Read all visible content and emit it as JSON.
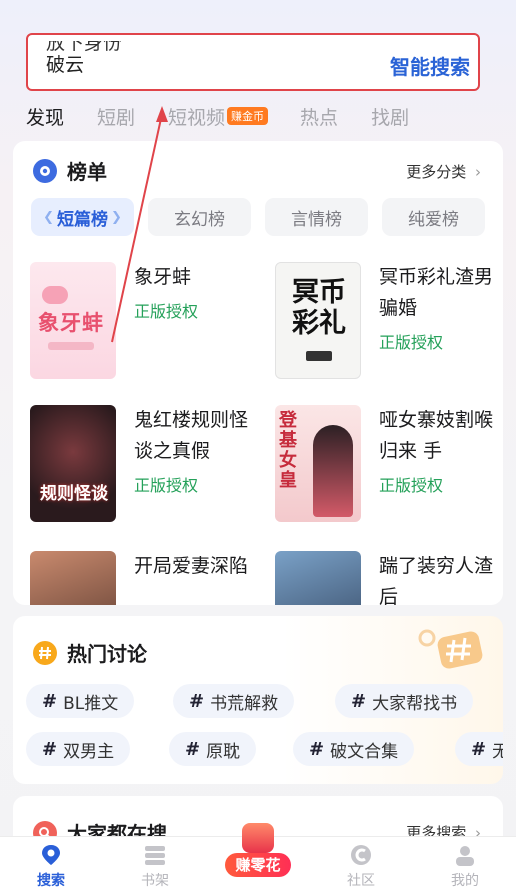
{
  "search": {
    "ticker_prev": "放下身份",
    "ticker_current": "破云",
    "button_label": "智能搜索"
  },
  "tabs": [
    {
      "label": "发现"
    },
    {
      "label": "短剧"
    },
    {
      "label": "短视频",
      "badge": "赚金币"
    },
    {
      "label": "热点"
    },
    {
      "label": "找剧"
    }
  ],
  "ranking": {
    "title": "榜单",
    "more_label": "更多分类",
    "categories": [
      "短篇榜",
      "玄幻榜",
      "言情榜",
      "纯爱榜"
    ],
    "books": [
      {
        "title": "象牙蚌",
        "license": "正版授权",
        "cover_text": "象牙蚌"
      },
      {
        "title": "冥币彩礼渣男骗婚",
        "license": "正版授权",
        "cover_text": "冥币彩礼"
      },
      {
        "title": "鬼红楼规则怪谈之真假",
        "license": "正版授权",
        "cover_text": "规则怪谈"
      },
      {
        "title": "哑女寨妓割喉归来 手",
        "license": "正版授权",
        "cover_text": "登基女皇"
      },
      {
        "title": "开局爱妻深陷",
        "license": "",
        "cover_text": ""
      },
      {
        "title": "踹了装穷人渣后",
        "license": "",
        "cover_text": ""
      }
    ]
  },
  "hot_discussion": {
    "title": "热门讨论",
    "topics_row1": [
      "BL推文",
      "书荒解救",
      "大家帮找书"
    ],
    "topics_row2": [
      "双男主",
      "原耽",
      "破文合集",
      "无"
    ]
  },
  "popular_search": {
    "title": "大家都在搜",
    "more_label": "更多搜索"
  },
  "bottom_nav": [
    {
      "label": "搜索",
      "icon": "search-icon"
    },
    {
      "label": "书架",
      "icon": "bookshelf-icon"
    },
    {
      "label": "赚零花",
      "icon": "red-packet-icon"
    },
    {
      "label": "社区",
      "icon": "community-icon"
    },
    {
      "label": "我的",
      "icon": "profile-icon"
    }
  ],
  "colors": {
    "accent": "#2a5fd8",
    "license_green": "#25a15a",
    "annotation_red": "#e0444a",
    "coin_orange": "#ff7a20"
  }
}
